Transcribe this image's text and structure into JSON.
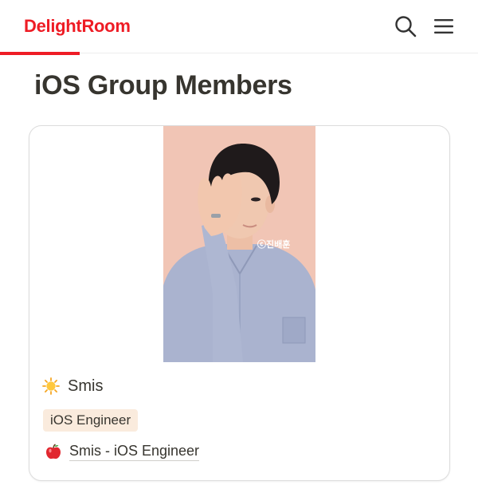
{
  "header": {
    "logo_text": "DelightRoom",
    "brand_color": "#ee1c25",
    "icons": [
      "search-icon",
      "hamburger-menu-icon"
    ]
  },
  "page": {
    "title": "iOS Group Members"
  },
  "member_card": {
    "name_icon": "sun-emoji-icon",
    "name": "Smis",
    "role_tag": "iOS Engineer",
    "link_icon": "apple-emoji-icon",
    "link_text": "Smis - iOS Engineer",
    "photo_watermark": "ⓒ진배훈"
  }
}
